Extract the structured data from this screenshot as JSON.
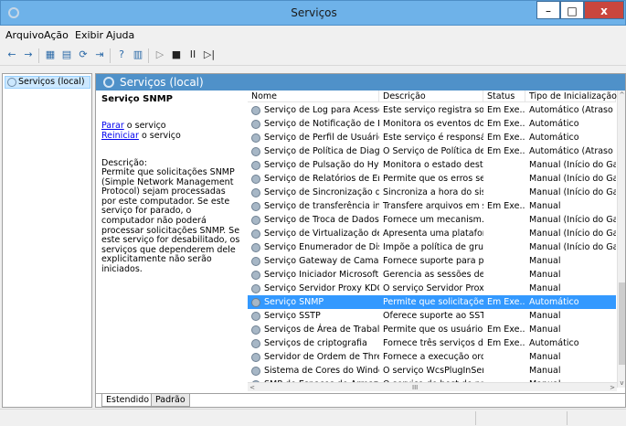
{
  "window": {
    "title": "Serviços",
    "min": "–",
    "max": "□",
    "close": "x"
  },
  "menu": [
    "Arquivo",
    "Ação",
    "Exibir",
    "Ajuda"
  ],
  "toolbar": [
    "←",
    "→",
    "▦",
    "▤",
    "⟳",
    "⇥",
    "?",
    "▥",
    "▷",
    "■",
    "II",
    "▷|"
  ],
  "tree": {
    "item": "Serviços (local)"
  },
  "panel": {
    "header": "Serviços (local)",
    "service_name": "Serviço SNMP",
    "stop_link": "Parar",
    "stop_rest": " o serviço",
    "restart_link": "Reiniciar",
    "restart_rest": " o serviço",
    "desc_label": "Descrição:",
    "desc_text": "Permite que solicitações SNMP (Simple Network Management Protocol) sejam processadas por este computador. Se este serviço for parado, o computador não poderá processar solicitações SNMP. Se este serviço for desabilitado, os serviços que dependerem dele explicitamente não serão iniciados."
  },
  "columns": [
    "Nome",
    "Descrição",
    "Status",
    "Tipo de Inicialização"
  ],
  "rows": [
    {
      "name": "Serviço de Log para Acesso d...",
      "desc": "Este serviço registra soli...",
      "status": "Em Exe...",
      "startup": "Automático (Atraso ..."
    },
    {
      "name": "Serviço de Notificação de Eve...",
      "desc": "Monitora os eventos do...",
      "status": "Em Exe...",
      "startup": "Automático"
    },
    {
      "name": "Serviço de Perfil de Usuário",
      "desc": "Este serviço é responsáv...",
      "status": "Em Exe...",
      "startup": "Automático"
    },
    {
      "name": "Serviço de Política de Diagnó...",
      "desc": "O Serviço de Política de ...",
      "status": "Em Exe...",
      "startup": "Automático (Atraso ..."
    },
    {
      "name": "Serviço de Pulsação do Hype...",
      "desc": "Monitora o estado dest...",
      "status": "",
      "startup": "Manual (Início do Ga..."
    },
    {
      "name": "Serviço de Relatórios de Erro ...",
      "desc": "Permite que os erros sej...",
      "status": "",
      "startup": "Manual (Início do Ga..."
    },
    {
      "name": "Serviço de Sincronização de ...",
      "desc": "Sincroniza a hora do sist...",
      "status": "",
      "startup": "Manual (Início do Ga..."
    },
    {
      "name": "Serviço de transferência inteli...",
      "desc": "Transfere arquivos em s...",
      "status": "Em Exe...",
      "startup": "Manual"
    },
    {
      "name": "Serviço de Troca de Dados d...",
      "desc": "Fornece um mecanism...",
      "status": "",
      "startup": "Manual (Início do Ga..."
    },
    {
      "name": "Serviço de Virtualização de Ár...",
      "desc": "Apresenta uma platafor...",
      "status": "",
      "startup": "Manual (Início do Ga..."
    },
    {
      "name": "Serviço Enumerador de Dispo...",
      "desc": "Impõe a política de gru...",
      "status": "",
      "startup": "Manual (Início do Ga..."
    },
    {
      "name": "Serviço Gateway de Camada ...",
      "desc": "Fornece suporte para pl...",
      "status": "",
      "startup": "Manual"
    },
    {
      "name": "Serviço Iniciador Microsoft iS...",
      "desc": "Gerencia as sessões de I...",
      "status": "",
      "startup": "Manual"
    },
    {
      "name": "Serviço Servidor Proxy KDC (...",
      "desc": "O serviço Servidor Proxy...",
      "status": "",
      "startup": "Manual"
    },
    {
      "name": "Serviço SNMP",
      "desc": "Permite que solicitaçõe...",
      "status": "Em Exe...",
      "startup": "Automático",
      "selected": true
    },
    {
      "name": "Serviço SSTP",
      "desc": "Oferece suporte ao SST...",
      "status": "",
      "startup": "Manual"
    },
    {
      "name": "Serviços de Área de Trabalho ...",
      "desc": "Permite que os usuários...",
      "status": "Em Exe...",
      "startup": "Manual"
    },
    {
      "name": "Serviços de criptografia",
      "desc": "Fornece três serviços de...",
      "status": "Em Exe...",
      "startup": "Automático"
    },
    {
      "name": "Servidor de Ordem de Thread",
      "desc": "Fornece a execução ord...",
      "status": "",
      "startup": "Manual"
    },
    {
      "name": "Sistema de Cores do Windows",
      "desc": "O serviço WcsPlugInSer...",
      "status": "",
      "startup": "Manual"
    },
    {
      "name": "SMP de Espaços de Armazen...",
      "desc": "O serviço de host do pr...",
      "status": "",
      "startup": "Manual"
    }
  ],
  "scroll": {
    "up": "^",
    "down": "v",
    "left": "<",
    "right": ">",
    "mid": "III",
    "grip": "≡"
  },
  "tabs": {
    "extended": "Estendido",
    "standard": "Padrão"
  }
}
